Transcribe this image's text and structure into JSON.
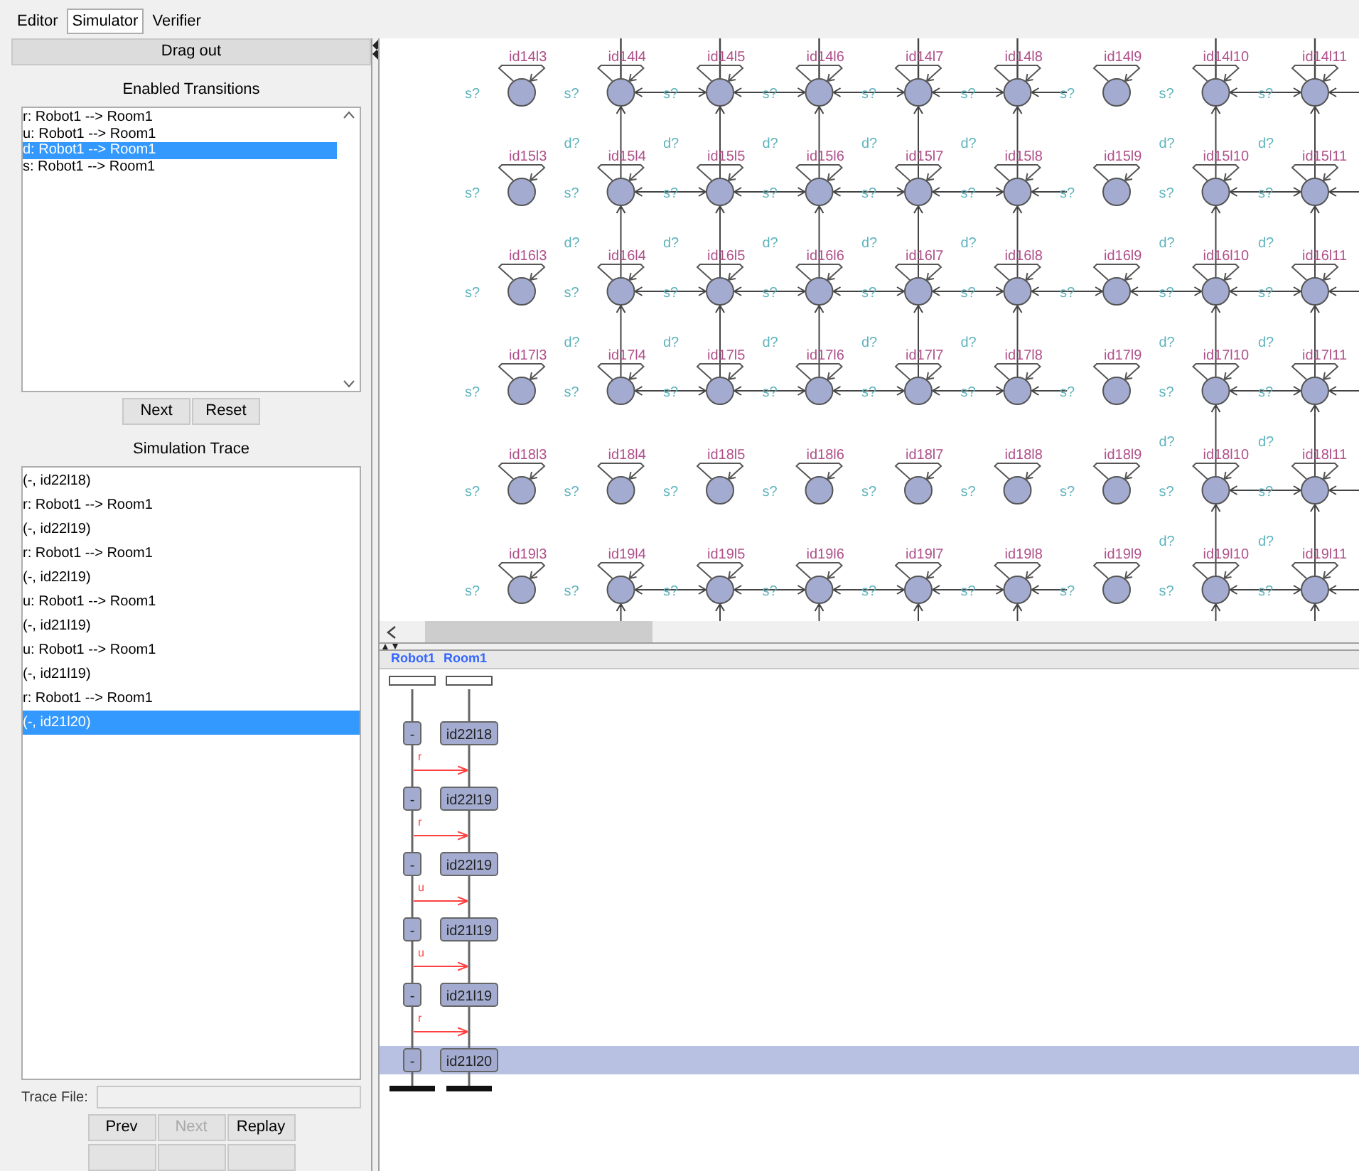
{
  "tabs": [
    {
      "label": "Editor",
      "selected": false
    },
    {
      "label": "Simulator",
      "selected": true
    },
    {
      "label": "Verifier",
      "selected": false
    }
  ],
  "drag_out": "Drag out",
  "enabled_transitions": {
    "title": "Enabled Transitions",
    "items": [
      {
        "text": "r: Robot1 --> Room1",
        "selected": false
      },
      {
        "text": "u: Robot1 --> Room1",
        "selected": false
      },
      {
        "text": "d: Robot1 --> Room1",
        "selected": true
      },
      {
        "text": "s: Robot1 --> Room1",
        "selected": false
      }
    ],
    "buttons": [
      {
        "label": "Next",
        "disabled": false
      },
      {
        "label": "Reset",
        "disabled": false
      }
    ]
  },
  "simulation_trace": {
    "title": "Simulation Trace",
    "items": [
      {
        "text": "(-, id22l18)",
        "selected": false
      },
      {
        "text": "r: Robot1 --> Room1",
        "selected": false
      },
      {
        "text": "(-, id22l19)",
        "selected": false
      },
      {
        "text": "r: Robot1 --> Room1",
        "selected": false
      },
      {
        "text": "(-, id22l19)",
        "selected": false
      },
      {
        "text": "u: Robot1 --> Room1",
        "selected": false
      },
      {
        "text": "(-, id21l19)",
        "selected": false
      },
      {
        "text": "u: Robot1 --> Room1",
        "selected": false
      },
      {
        "text": "(-, id21l19)",
        "selected": false
      },
      {
        "text": "r: Robot1 --> Room1",
        "selected": false
      },
      {
        "text": "(-, id21l20)",
        "selected": true
      }
    ],
    "trace_file_label": "Trace File:",
    "buttons": [
      {
        "label": "Prev",
        "disabled": false
      },
      {
        "label": "Next",
        "disabled": true
      },
      {
        "label": "Replay",
        "disabled": false
      }
    ]
  },
  "diagram": {
    "rows": [
      {
        "nodes": [
          {
            "label": "id14l3",
            "sync": "s?",
            "in_left": false,
            "in_right": false,
            "down": false,
            "up": false
          },
          {
            "label": "id14l4",
            "sync": "s?",
            "in_left": false,
            "in_right": true,
            "down": true,
            "up": true,
            "d": "d?"
          },
          {
            "label": "id14l5",
            "sync": "s?",
            "in_left": true,
            "in_right": true,
            "down": true,
            "up": true,
            "d": "d?"
          },
          {
            "label": "id14l6",
            "sync": "s?",
            "in_left": true,
            "in_right": true,
            "down": true,
            "up": true,
            "d": "d?"
          },
          {
            "label": "id14l7",
            "sync": "s?",
            "in_left": true,
            "in_right": true,
            "down": true,
            "up": true,
            "d": "d?"
          },
          {
            "label": "id14l8",
            "sync": "s?",
            "in_left": true,
            "in_right": true,
            "down": true,
            "up": true,
            "d": "d?"
          },
          {
            "label": "id14l9",
            "sync": "s?",
            "in_left": false,
            "in_right": false,
            "down": false,
            "up": false
          },
          {
            "label": "id14l10",
            "sync": "s?",
            "in_left": false,
            "in_right": true,
            "down": true,
            "up": true,
            "d": "d?"
          },
          {
            "label": "id14l11",
            "sync": "s?",
            "in_left": true,
            "in_right": true,
            "down": true,
            "up": true,
            "d": "d?"
          }
        ]
      },
      {
        "nodes": [
          {
            "label": "id15l3",
            "sync": "s?",
            "in_left": false,
            "in_right": false,
            "down": false
          },
          {
            "label": "id15l4",
            "sync": "s?",
            "in_left": false,
            "in_right": true,
            "down": true,
            "d": "d?"
          },
          {
            "label": "id15l5",
            "sync": "s?",
            "in_left": true,
            "in_right": true,
            "down": true,
            "d": "d?"
          },
          {
            "label": "id15l6",
            "sync": "s?",
            "in_left": true,
            "in_right": true,
            "down": true,
            "d": "d?"
          },
          {
            "label": "id15l7",
            "sync": "s?",
            "in_left": true,
            "in_right": true,
            "down": true,
            "d": "d?"
          },
          {
            "label": "id15l8",
            "sync": "s?",
            "in_left": true,
            "in_right": true,
            "down": true,
            "d": "d?"
          },
          {
            "label": "id15l9",
            "sync": "s?",
            "in_left": false,
            "in_right": false,
            "down": false
          },
          {
            "label": "id15l10",
            "sync": "s?",
            "in_left": false,
            "in_right": true,
            "down": true,
            "d": "d?"
          },
          {
            "label": "id15l11",
            "sync": "s?",
            "in_left": true,
            "in_right": true,
            "down": true,
            "d": "d?"
          }
        ]
      },
      {
        "nodes": [
          {
            "label": "id16l3",
            "sync": "s?",
            "in_left": false,
            "in_right": false,
            "down": false
          },
          {
            "label": "id16l4",
            "sync": "s?",
            "in_left": false,
            "in_right": true,
            "down": true,
            "d": "d?"
          },
          {
            "label": "id16l5",
            "sync": "s?",
            "in_left": true,
            "in_right": true,
            "down": true,
            "d": "d?"
          },
          {
            "label": "id16l6",
            "sync": "s?",
            "in_left": true,
            "in_right": true,
            "down": true,
            "d": "d?"
          },
          {
            "label": "id16l7",
            "sync": "s?",
            "in_left": true,
            "in_right": true,
            "down": true,
            "d": "d?"
          },
          {
            "label": "id16l8",
            "sync": "s?",
            "in_left": true,
            "in_right": true,
            "down": true,
            "d": "d?"
          },
          {
            "label": "id16l9",
            "sync": "s?",
            "in_left": true,
            "in_right": true,
            "down": false
          },
          {
            "label": "id16l10",
            "sync": "s?",
            "in_left": true,
            "in_right": true,
            "down": true,
            "d": "d?"
          },
          {
            "label": "id16l11",
            "sync": "s?",
            "in_left": true,
            "in_right": true,
            "down": true,
            "d": "d?"
          }
        ]
      },
      {
        "nodes": [
          {
            "label": "id17l3",
            "sync": "s?",
            "in_left": false,
            "in_right": false,
            "down": false
          },
          {
            "label": "id17l4",
            "sync": "s?",
            "in_left": false,
            "in_right": true,
            "down": false
          },
          {
            "label": "id17l5",
            "sync": "s?",
            "in_left": true,
            "in_right": true,
            "down": false
          },
          {
            "label": "id17l6",
            "sync": "s?",
            "in_left": true,
            "in_right": true,
            "down": false
          },
          {
            "label": "id17l7",
            "sync": "s?",
            "in_left": true,
            "in_right": true,
            "down": false
          },
          {
            "label": "id17l8",
            "sync": "s?",
            "in_left": true,
            "in_right": true,
            "down": false
          },
          {
            "label": "id17l9",
            "sync": "s?",
            "in_left": false,
            "in_right": false,
            "down": false
          },
          {
            "label": "id17l10",
            "sync": "s?",
            "in_left": false,
            "in_right": true,
            "down": true,
            "d": "d?"
          },
          {
            "label": "id17l11",
            "sync": "s?",
            "in_left": true,
            "in_right": true,
            "down": true,
            "d": "d?"
          }
        ]
      },
      {
        "nodes": [
          {
            "label": "id18l3",
            "sync": "s?",
            "in_left": false,
            "in_right": false,
            "down": false
          },
          {
            "label": "id18l4",
            "sync": "s?",
            "in_left": false,
            "in_right": false,
            "down": false
          },
          {
            "label": "id18l5",
            "sync": "s?",
            "in_left": false,
            "in_right": false,
            "down": false
          },
          {
            "label": "id18l6",
            "sync": "s?",
            "in_left": false,
            "in_right": false,
            "down": false
          },
          {
            "label": "id18l7",
            "sync": "s?",
            "in_left": false,
            "in_right": false,
            "down": false
          },
          {
            "label": "id18l8",
            "sync": "s?",
            "in_left": false,
            "in_right": false,
            "down": false
          },
          {
            "label": "id18l9",
            "sync": "s?",
            "in_left": false,
            "in_right": false,
            "down": false
          },
          {
            "label": "id18l10",
            "sync": "s?",
            "in_left": false,
            "in_right": true,
            "down": true,
            "d": "d?"
          },
          {
            "label": "id18l11",
            "sync": "s?",
            "in_left": true,
            "in_right": true,
            "down": true,
            "d": "d?"
          }
        ]
      },
      {
        "nodes": [
          {
            "label": "id19l3",
            "sync": "s?",
            "in_left": false,
            "in_right": false,
            "down": false
          },
          {
            "label": "id19l4",
            "sync": "s?",
            "in_left": false,
            "in_right": true,
            "down": true
          },
          {
            "label": "id19l5",
            "sync": "s?",
            "in_left": true,
            "in_right": true,
            "down": true
          },
          {
            "label": "id19l6",
            "sync": "s?",
            "in_left": true,
            "in_right": true,
            "down": true
          },
          {
            "label": "id19l7",
            "sync": "s?",
            "in_left": true,
            "in_right": true,
            "down": true
          },
          {
            "label": "id19l8",
            "sync": "s?",
            "in_left": true,
            "in_right": true,
            "down": true
          },
          {
            "label": "id19l9",
            "sync": "s?",
            "in_left": false,
            "in_right": false,
            "down": false
          },
          {
            "label": "id19l10",
            "sync": "s?",
            "in_left": false,
            "in_right": true,
            "down": true
          },
          {
            "label": "id19l11",
            "sync": "s?",
            "in_left": true,
            "in_right": true,
            "down": true
          }
        ]
      }
    ]
  },
  "sequence_chart": {
    "processes": [
      "Robot1",
      "Room1"
    ],
    "states": [
      {
        "robot": "-",
        "room": "id22l18",
        "selected": false,
        "message": "r"
      },
      {
        "robot": "-",
        "room": "id22l19",
        "selected": false,
        "message": "r"
      },
      {
        "robot": "-",
        "room": "id22l19",
        "selected": false,
        "message": "u"
      },
      {
        "robot": "-",
        "room": "id21l19",
        "selected": false,
        "message": "u"
      },
      {
        "robot": "-",
        "room": "id21l19",
        "selected": false,
        "message": "r"
      },
      {
        "robot": "-",
        "room": "id21l20",
        "selected": true
      }
    ]
  }
}
